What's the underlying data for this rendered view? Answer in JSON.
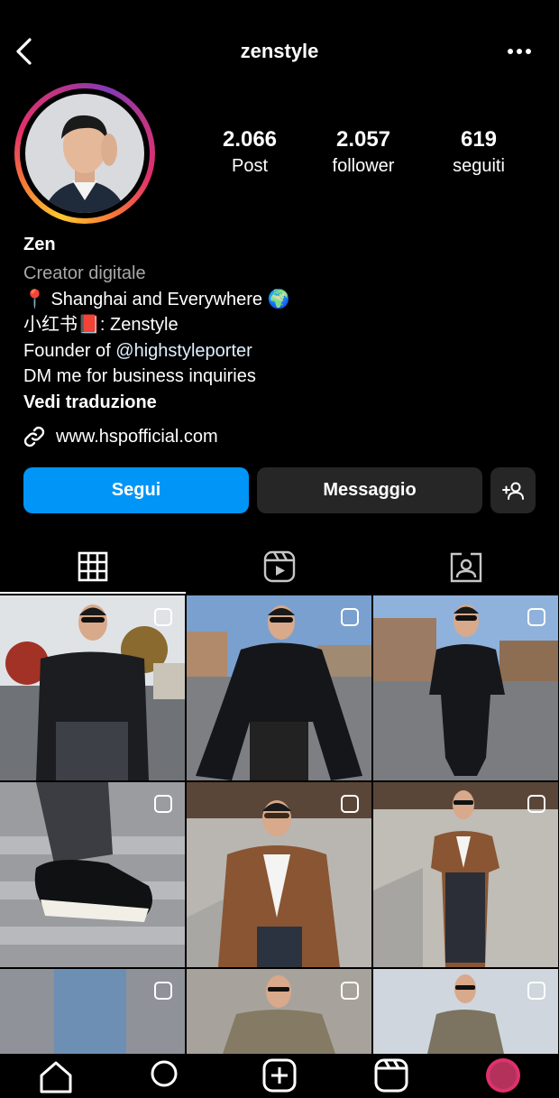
{
  "header": {
    "username": "zenstyle",
    "back_icon": "chevron-left-icon",
    "more_icon": "more-horizontal-icon"
  },
  "profile": {
    "stats": [
      {
        "value": "2.066",
        "label": "Post"
      },
      {
        "value": "2.057",
        "label": "follower"
      },
      {
        "value": "619",
        "label": "seguiti"
      }
    ],
    "name": "Zen",
    "category": "Creator digitale",
    "bio_line1": "📍 Shanghai and Everywhere 🌍",
    "bio_line2": "小红书📕: Zenstyle",
    "bio_line3_prefix": "Founder of ",
    "bio_line3_mention": "@highstyleporter",
    "bio_line4": "DM me for business inquiries",
    "see_translation": "Vedi traduzione",
    "website": "www.hspofficial.com"
  },
  "actions": {
    "follow_label": "Segui",
    "message_label": "Messaggio",
    "add_person_icon": "add-person-icon"
  },
  "tabs": [
    {
      "icon": "grid-icon",
      "active": true
    },
    {
      "icon": "reels-icon",
      "active": false
    },
    {
      "icon": "tagged-icon",
      "active": false
    }
  ],
  "colors": {
    "primary_button": "#0095f6",
    "secondary_button": "#262626",
    "background": "#000000",
    "muted_text": "#a8a8a8"
  },
  "bottom_nav": [
    {
      "icon": "home-icon"
    },
    {
      "icon": "search-icon"
    },
    {
      "icon": "new-post-icon"
    },
    {
      "icon": "reels-icon"
    },
    {
      "icon": "profile-avatar"
    }
  ]
}
